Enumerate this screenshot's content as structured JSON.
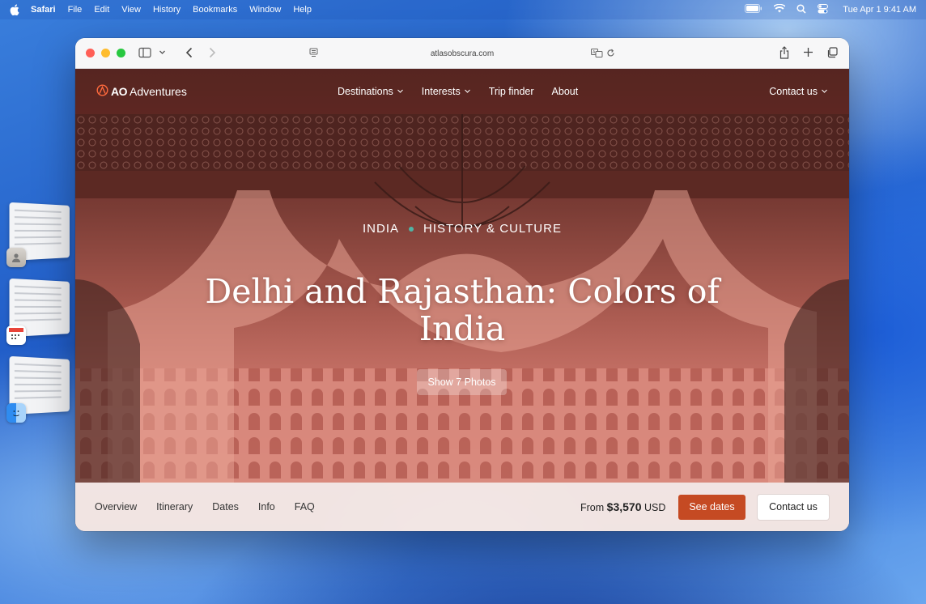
{
  "menubar": {
    "app_name": "Safari",
    "menus": [
      "File",
      "Edit",
      "View",
      "History",
      "Bookmarks",
      "Window",
      "Help"
    ],
    "clock": "Tue Apr 1  9:41 AM"
  },
  "browser": {
    "url": "atlasobscura.com"
  },
  "site": {
    "logo_ao": "AO",
    "logo_name": "Adventures",
    "nav": [
      "Destinations",
      "Interests",
      "Trip finder",
      "About"
    ],
    "contact": "Contact us"
  },
  "hero": {
    "country": "INDIA",
    "category": "HISTORY & CULTURE",
    "title": "Delhi and Rajasthan: Colors of India",
    "photos_button": "Show 7 Photos"
  },
  "bottom": {
    "tabs": [
      "Overview",
      "Itinerary",
      "Dates",
      "Info",
      "FAQ"
    ],
    "price_prefix": "From",
    "price": "$3,570",
    "currency": "USD",
    "see_dates": "See dates",
    "contact": "Contact us"
  },
  "colors": {
    "accent_orange": "#c54a23",
    "dot_teal": "#4fb5a6",
    "traffic_red": "#ff5f57",
    "traffic_yellow": "#febc2e",
    "traffic_green": "#28c840"
  }
}
